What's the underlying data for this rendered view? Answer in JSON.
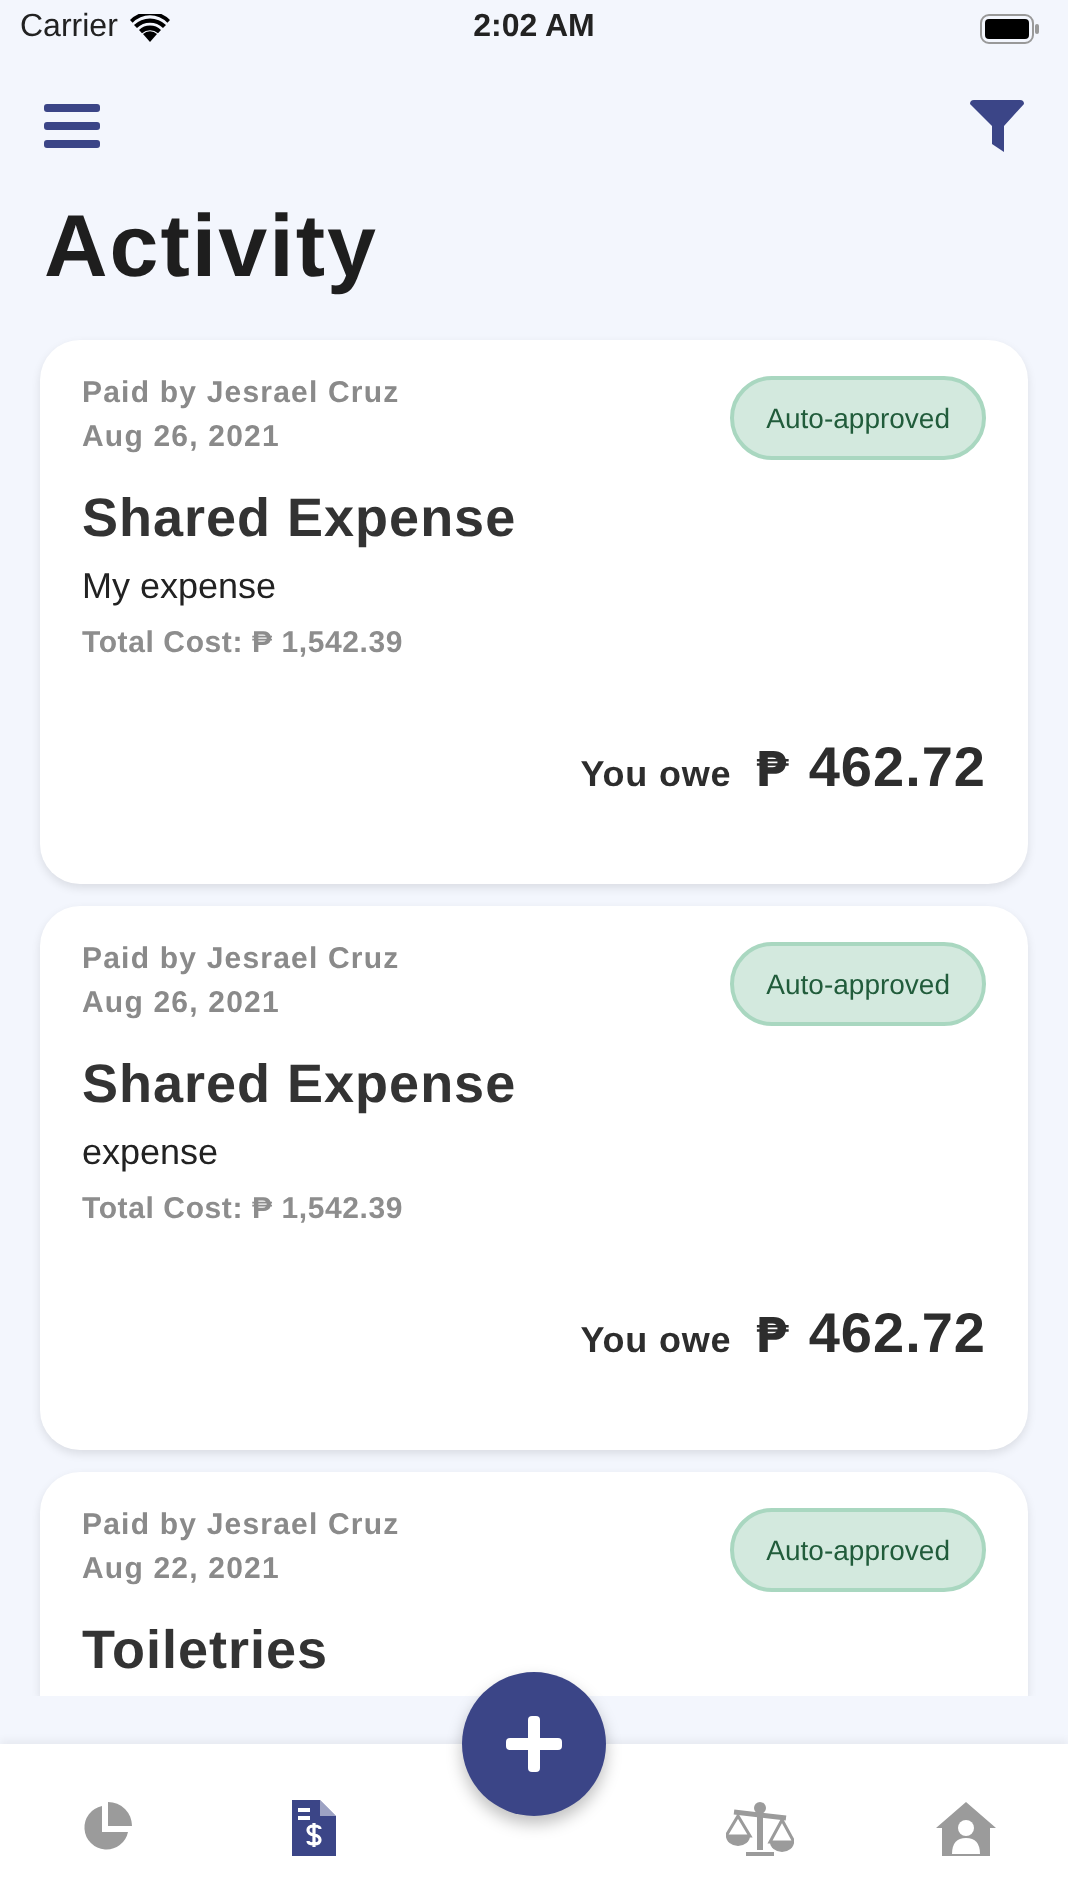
{
  "status_bar": {
    "carrier": "Carrier",
    "time": "2:02 AM"
  },
  "title": "Activity",
  "cards": [
    {
      "paid_by": "Paid by Jesrael Cruz",
      "date": "Aug 26, 2021",
      "status": "Auto-approved",
      "title": "Shared Expense",
      "description": "My expense",
      "total": "Total Cost: ₱ 1,542.39",
      "owe_label": "You owe",
      "currency": "₱",
      "amount": "462.72"
    },
    {
      "paid_by": "Paid by Jesrael Cruz",
      "date": "Aug 26, 2021",
      "status": "Auto-approved",
      "title": "Shared Expense",
      "description": "expense",
      "total": "Total Cost: ₱ 1,542.39",
      "owe_label": "You owe",
      "currency": "₱",
      "amount": "462.72"
    },
    {
      "paid_by": "Paid by Jesrael Cruz",
      "date": "Aug 22, 2021",
      "status": "Auto-approved",
      "title": "Toiletries"
    }
  ],
  "tab_bar": [
    {
      "kind": "pie",
      "selected": false
    },
    {
      "kind": "invoice",
      "selected": true
    },
    {
      "kind": "scale",
      "selected": false
    },
    {
      "kind": "home",
      "selected": false
    }
  ]
}
